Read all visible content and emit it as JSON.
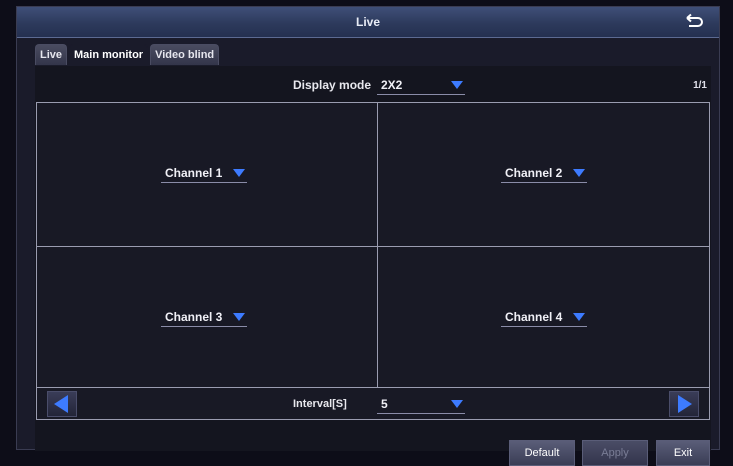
{
  "window": {
    "title": "Live"
  },
  "tabs": [
    {
      "label": "Live",
      "active": false
    },
    {
      "label": "Main monitor",
      "active": true
    },
    {
      "label": "Video blind",
      "active": false
    }
  ],
  "display_mode": {
    "label": "Display mode",
    "value": "2X2"
  },
  "page_indicator": "1/1",
  "channels": [
    {
      "value": "Channel 1"
    },
    {
      "value": "Channel 2"
    },
    {
      "value": "Channel 3"
    },
    {
      "value": "Channel 4"
    }
  ],
  "interval": {
    "label": "Interval[S]",
    "value": "5"
  },
  "buttons": {
    "default": "Default",
    "apply": "Apply",
    "exit": "Exit"
  },
  "colors": {
    "accent": "#3d7bff",
    "titlebar": "#2d3a5c",
    "background": "#1a1b2a"
  }
}
